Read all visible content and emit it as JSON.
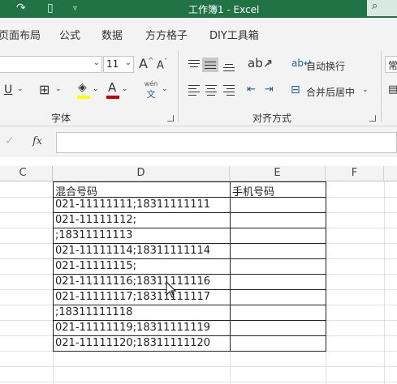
{
  "window": {
    "title": "工作簿1  -  Excel",
    "search_glyph": "⌕",
    "qat_icons": [
      "redo-icon",
      "touch-mode-icon",
      "customize-qat-icon"
    ]
  },
  "tabs": [
    {
      "label": "页面布局"
    },
    {
      "label": "公式"
    },
    {
      "label": "数据"
    },
    {
      "label": "方方格子"
    },
    {
      "label": "DIY工具箱"
    }
  ],
  "ribbon": {
    "font_size": "11",
    "font_grow": "A",
    "font_shrink": "A",
    "underline": "U",
    "font_color_glyph": "A",
    "font_color": "#c00000",
    "highlight_color": "#ffff00",
    "phonetic_top": "wén",
    "phonetic_bottom": "文",
    "font_group_label": "字体",
    "wrap_text_label": "自动换行",
    "merge_center_label": "合并后居中",
    "align_group_label": "对齐方式",
    "cut_off_label": "常"
  },
  "formula_bar": {
    "cancel_glyph": "✓",
    "fx_label": "fx",
    "value": ""
  },
  "columns": [
    "C",
    "D",
    "E",
    "F"
  ],
  "table": {
    "headers": [
      "混合号码",
      "手机号码"
    ],
    "rows": [
      [
        "021-11111111;18311111111",
        ""
      ],
      [
        "021-11111112;",
        ""
      ],
      [
        ";18311111113",
        ""
      ],
      [
        "021-11111114;18311111114",
        ""
      ],
      [
        "021-11111115;",
        ""
      ],
      [
        "021-11111116;18311111116",
        ""
      ],
      [
        "021-11111117;18311111117",
        ""
      ],
      [
        ";18311111118",
        ""
      ],
      [
        "021-11111119;18311111119",
        ""
      ],
      [
        "021-11111120;18311111120",
        ""
      ]
    ]
  }
}
